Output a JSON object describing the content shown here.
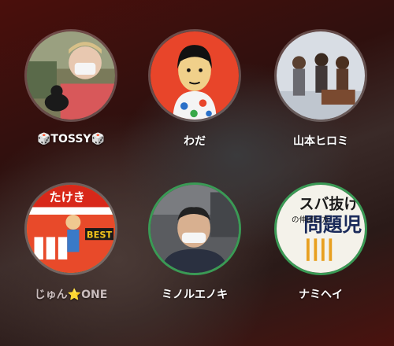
{
  "friends": [
    {
      "name": "🎲TOSSY🎲",
      "icon": "avatar-photo-man-with-dog"
    },
    {
      "name": "わだ",
      "icon": "avatar-illustration-red"
    },
    {
      "name": "山本ヒロミ",
      "icon": "avatar-photo-band"
    },
    {
      "name": "じゅん⭐ONE",
      "icon": "avatar-illustration-game"
    },
    {
      "name": "ミノルエノキ",
      "icon": "avatar-photo-man-mask"
    },
    {
      "name": "ナミヘイ",
      "icon": "avatar-book-cover"
    }
  ],
  "book_cover": {
    "title_line1": "スバ抜けた",
    "title_line2": "問題児",
    "subtitle": "の伸ばし方"
  },
  "game_art": {
    "sign": "たけき",
    "badge": "BEST"
  },
  "colors": {
    "highlight_border": "#3a9a55",
    "background": "#3a1210"
  }
}
